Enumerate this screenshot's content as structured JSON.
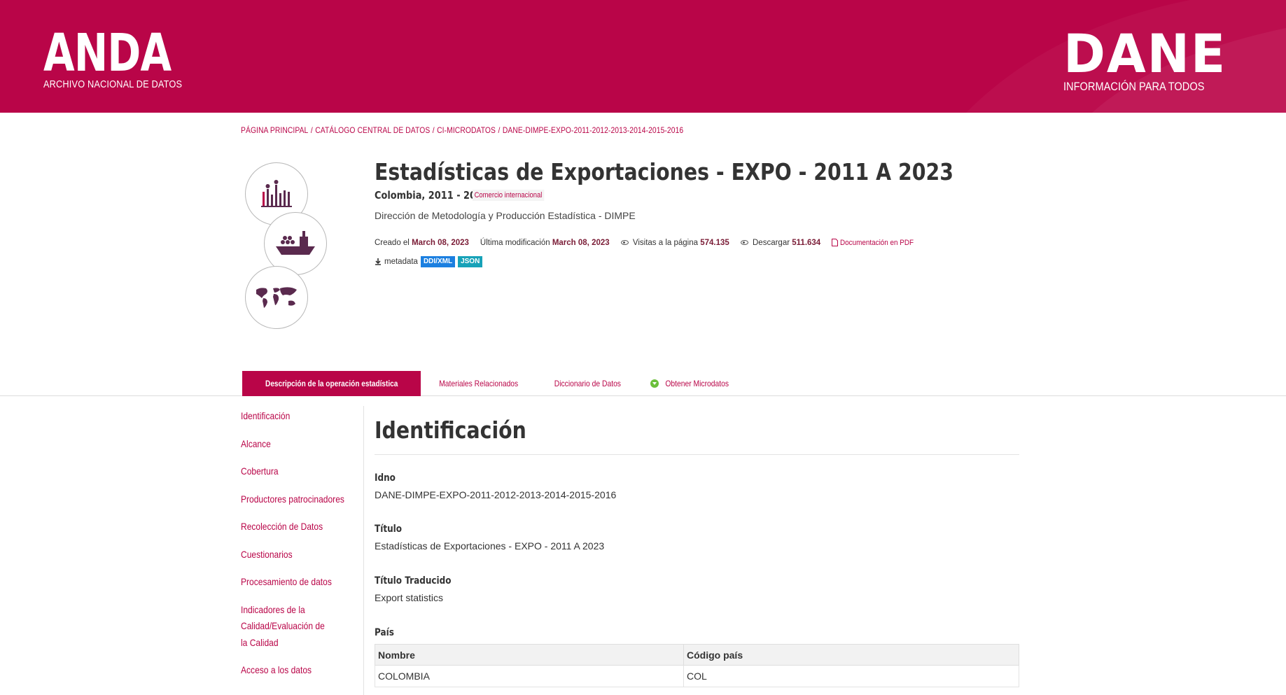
{
  "header": {
    "site_title": "ANDA",
    "site_subtitle": "ARCHIVO NACIONAL DE DATOS",
    "org_title": "DANE",
    "org_subtitle": "INFORMACIÓN PARA TODOS",
    "brand_color": "#b90548"
  },
  "breadcrumb": {
    "items": [
      "PÁGINA PRINCIPAL",
      "CATÁLOGO CENTRAL DE DATOS",
      "CI-MICRODATOS",
      "DANE-DIMPE-EXPO-2011-2012-2013-2014-2015-2016"
    ],
    "separator": "/"
  },
  "study": {
    "title": "Estadísticas de Exportaciones - EXPO - 2011 A 2023",
    "country_years": "Colombia, 2011 - 2023",
    "topic_tag": "Comercio internacional",
    "agency": "Dirección de Metodología y Producción Estadística - DIMPE",
    "created_label": "Creado el",
    "created_value": "March 08, 2023",
    "modified_label": "Última modificación",
    "modified_value": "March 08, 2023",
    "views_label": "Visitas a la página",
    "views_value": "574.135",
    "downloads_label": "Descargar",
    "downloads_value": "511.634",
    "pdf_label": "Documentación en PDF",
    "metadata_label": "metadata",
    "badge_ddi": "DDI/XML",
    "badge_json": "JSON",
    "icons": [
      "bar-chart-icon",
      "cargo-ship-icon",
      "world-map-icon"
    ]
  },
  "tabs": [
    {
      "label": "Descripción de la operación estadística",
      "active": true
    },
    {
      "label": "Materiales Relacionados",
      "active": false
    },
    {
      "label": "Diccionario de Datos",
      "active": false
    },
    {
      "label": "Obtener Microdatos",
      "active": false
    }
  ],
  "sidebar": {
    "items": [
      "Identificación",
      "Alcance",
      "Cobertura",
      "Productores patrocinadores",
      "Recolección de Datos",
      "Cuestionarios",
      "Procesamiento de datos",
      "Indicadores de la Calidad/Evaluación de la Calidad",
      "Acceso a los datos"
    ]
  },
  "content": {
    "section_title": "Identificación",
    "fields": [
      {
        "label": "Idno",
        "value": "DANE-DIMPE-EXPO-2011-2012-2013-2014-2015-2016"
      },
      {
        "label": "Título",
        "value": "Estadísticas de Exportaciones - EXPO - 2011 A 2023"
      },
      {
        "label": "Título Traducido",
        "value": "Export statistics"
      },
      {
        "label": "País",
        "value": ""
      }
    ],
    "country_table": {
      "headers": [
        "Nombre",
        "Código país"
      ],
      "rows": [
        [
          "COLOMBIA",
          "COL"
        ]
      ]
    }
  }
}
